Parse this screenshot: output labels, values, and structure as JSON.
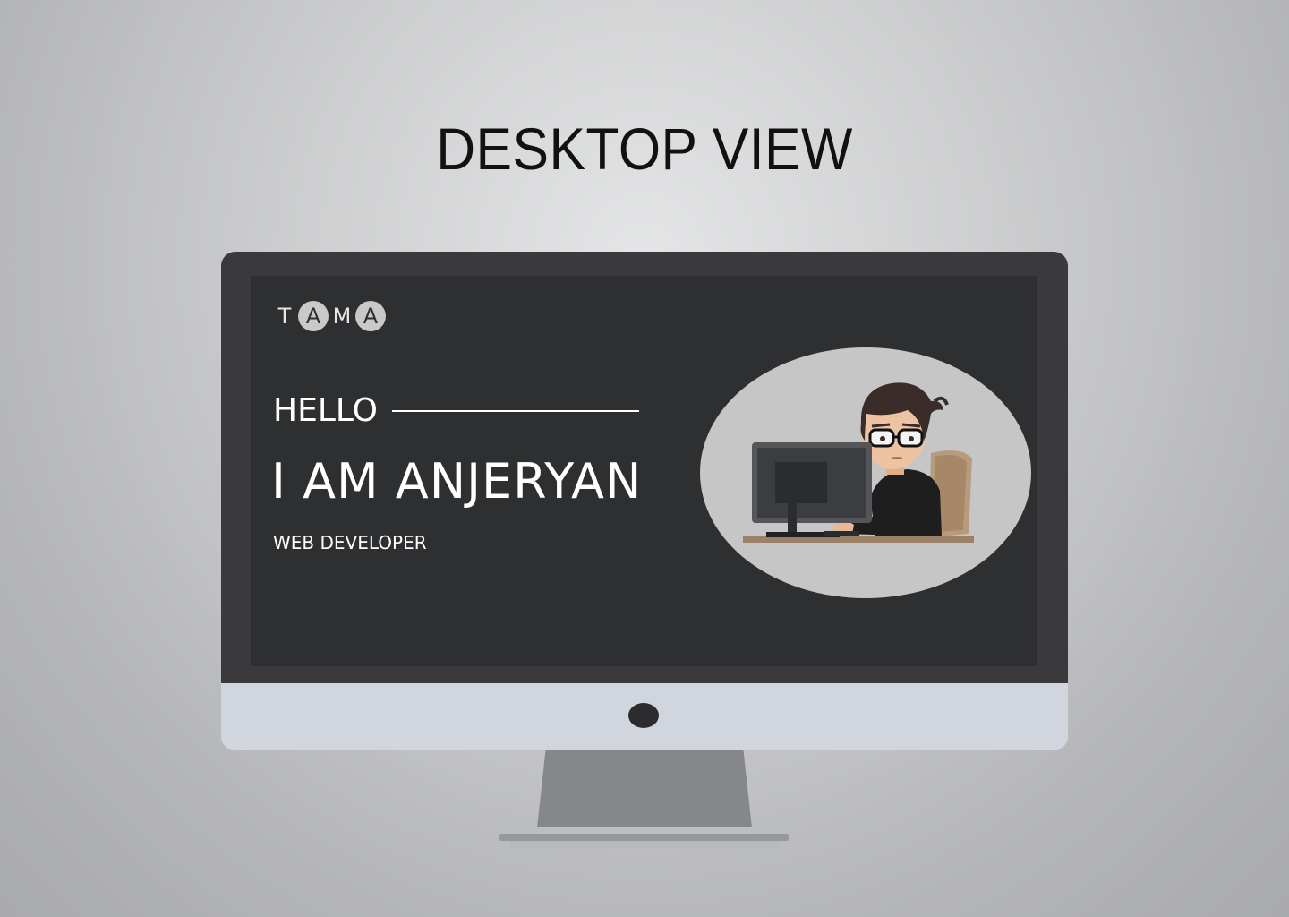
{
  "page": {
    "heading": "DESKTOP VIEW"
  },
  "site": {
    "logo": {
      "letters": [
        "T",
        "A",
        "M",
        "A"
      ],
      "circled": [
        false,
        true,
        false,
        true
      ]
    },
    "hero": {
      "greeting": "HELLO",
      "name": "I AM ANJERYAN",
      "role": "WEB DEVELOPER"
    },
    "illustration": {
      "icon": "developer-at-computer-illustration"
    }
  },
  "colors": {
    "background": "#c4c5c7",
    "bezel": "#3a3a3c",
    "screen": "#2e2f31",
    "chin": "#d1d6de",
    "stand": "#85878b",
    "text_light": "#ffffff",
    "avatar_bg": "#c6c6c6"
  }
}
